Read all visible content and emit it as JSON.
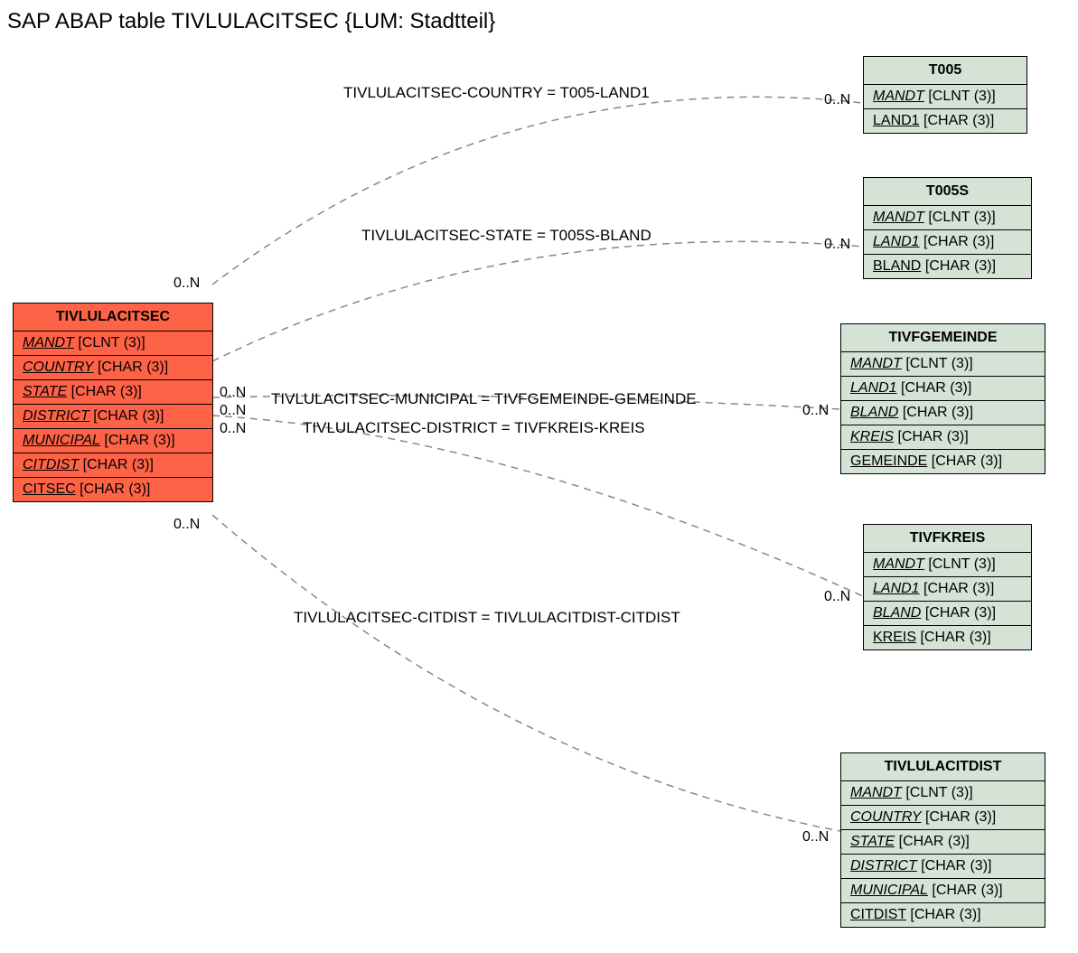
{
  "title": "SAP ABAP table TIVLULACITSEC {LUM: Stadtteil}",
  "entities": {
    "main": {
      "name": "TIVLULACITSEC",
      "fields": [
        {
          "name": "MANDT",
          "type": "[CLNT (3)]",
          "fk": true
        },
        {
          "name": "COUNTRY",
          "type": "[CHAR (3)]",
          "fk": true
        },
        {
          "name": "STATE",
          "type": "[CHAR (3)]",
          "fk": true
        },
        {
          "name": "DISTRICT",
          "type": "[CHAR (3)]",
          "fk": true
        },
        {
          "name": "MUNICIPAL",
          "type": "[CHAR (3)]",
          "fk": true
        },
        {
          "name": "CITDIST",
          "type": "[CHAR (3)]",
          "fk": true
        },
        {
          "name": "CITSEC",
          "type": "[CHAR (3)]",
          "pk": true
        }
      ]
    },
    "t005": {
      "name": "T005",
      "fields": [
        {
          "name": "MANDT",
          "type": "[CLNT (3)]",
          "fk": true
        },
        {
          "name": "LAND1",
          "type": "[CHAR (3)]",
          "pk": true
        }
      ]
    },
    "t005s": {
      "name": "T005S",
      "fields": [
        {
          "name": "MANDT",
          "type": "[CLNT (3)]",
          "fk": true
        },
        {
          "name": "LAND1",
          "type": "[CHAR (3)]",
          "fk": true
        },
        {
          "name": "BLAND",
          "type": "[CHAR (3)]",
          "pk": true
        }
      ]
    },
    "tivfgemeinde": {
      "name": "TIVFGEMEINDE",
      "fields": [
        {
          "name": "MANDT",
          "type": "[CLNT (3)]",
          "fk": true
        },
        {
          "name": "LAND1",
          "type": "[CHAR (3)]",
          "fk": true
        },
        {
          "name": "BLAND",
          "type": "[CHAR (3)]",
          "fk": true
        },
        {
          "name": "KREIS",
          "type": "[CHAR (3)]",
          "fk": true
        },
        {
          "name": "GEMEINDE",
          "type": "[CHAR (3)]",
          "pk": true
        }
      ]
    },
    "tivfkreis": {
      "name": "TIVFKREIS",
      "fields": [
        {
          "name": "MANDT",
          "type": "[CLNT (3)]",
          "fk": true
        },
        {
          "name": "LAND1",
          "type": "[CHAR (3)]",
          "fk": true
        },
        {
          "name": "BLAND",
          "type": "[CHAR (3)]",
          "fk": true
        },
        {
          "name": "KREIS",
          "type": "[CHAR (3)]",
          "pk": true
        }
      ]
    },
    "tivlulacitdist": {
      "name": "TIVLULACITDIST",
      "fields": [
        {
          "name": "MANDT",
          "type": "[CLNT (3)]",
          "fk": true
        },
        {
          "name": "COUNTRY",
          "type": "[CHAR (3)]",
          "fk": true
        },
        {
          "name": "STATE",
          "type": "[CHAR (3)]",
          "fk": true
        },
        {
          "name": "DISTRICT",
          "type": "[CHAR (3)]",
          "fk": true
        },
        {
          "name": "MUNICIPAL",
          "type": "[CHAR (3)]",
          "fk": true
        },
        {
          "name": "CITDIST",
          "type": "[CHAR (3)]",
          "pk": true
        }
      ]
    }
  },
  "relations": [
    {
      "label": "TIVLULACITSEC-COUNTRY = T005-LAND1"
    },
    {
      "label": "TIVLULACITSEC-STATE = T005S-BLAND"
    },
    {
      "label": "TIVLULACITSEC-MUNICIPAL = TIVFGEMEINDE-GEMEINDE"
    },
    {
      "label": "TIVLULACITSEC-DISTRICT = TIVFKREIS-KREIS"
    },
    {
      "label": "TIVLULACITSEC-CITDIST = TIVLULACITDIST-CITDIST"
    }
  ],
  "cardinality": "0..N"
}
